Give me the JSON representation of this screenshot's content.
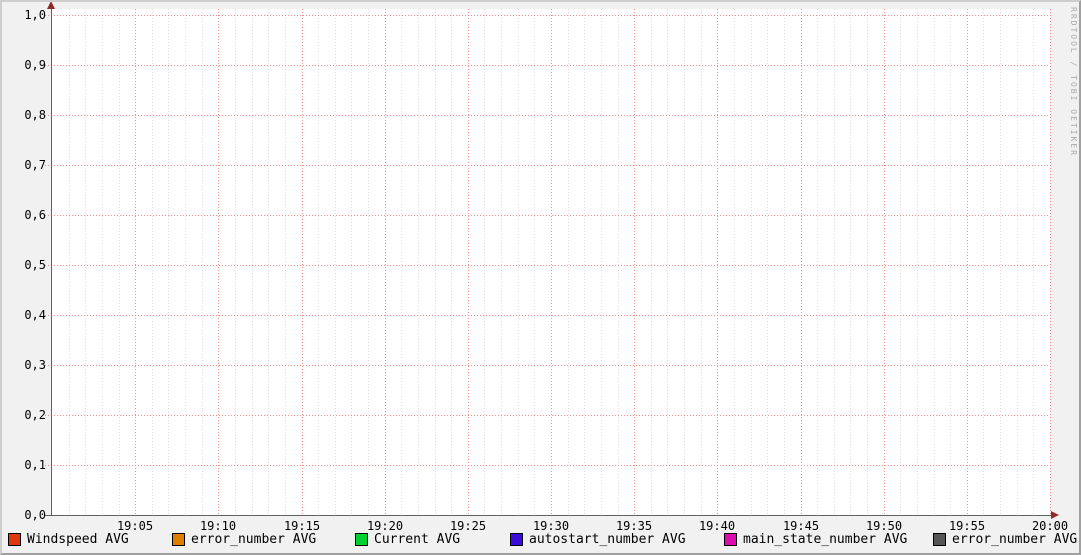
{
  "watermark": "RRDTOOL / TOBI OETIKER",
  "colors": {
    "background": "#F1F1F1",
    "canvas": "#FFFFFF",
    "major_grid": "#F08E8E",
    "minor_grid": "#DCDCDC",
    "axis": "#606060",
    "arrow": "#8F2A2A",
    "text": "#000000",
    "watermark_text": "#ABABAB",
    "shade_light": "#CDCDCD",
    "shade_dark": "#A0A0A0"
  },
  "chart_data": {
    "type": "line",
    "title": "",
    "grid": true,
    "legend_position": "bottom",
    "x_axis": {
      "tick_labels": [
        "19:05",
        "19:10",
        "19:15",
        "19:20",
        "19:25",
        "19:30",
        "19:35",
        "19:40",
        "19:45",
        "19:50",
        "19:55",
        "20:00"
      ],
      "range_minutes": 60,
      "major_step_minutes": 5,
      "minor_step_minutes": 1
    },
    "y_axis": {
      "tick_labels": [
        "0,0",
        "0,1",
        "0,2",
        "0,3",
        "0,4",
        "0,5",
        "0,6",
        "0,7",
        "0,8",
        "0,9",
        "1,0"
      ],
      "min": 0.0,
      "max": 1.0,
      "major_step": 0.1
    },
    "series": [
      {
        "name": "Windspeed AVG",
        "color": "#E0380D",
        "values": []
      },
      {
        "name": "error_number AVG",
        "color": "#DE7E00",
        "values": []
      },
      {
        "name": "Current AVG",
        "color": "#00D030",
        "values": []
      },
      {
        "name": "autostart_number AVG",
        "color": "#3A0CDC",
        "values": []
      },
      {
        "name": "main_state_number AVG",
        "color": "#DC0CAE",
        "values": []
      },
      {
        "name": "error_number AVG",
        "color": "#555555",
        "values": []
      }
    ]
  }
}
